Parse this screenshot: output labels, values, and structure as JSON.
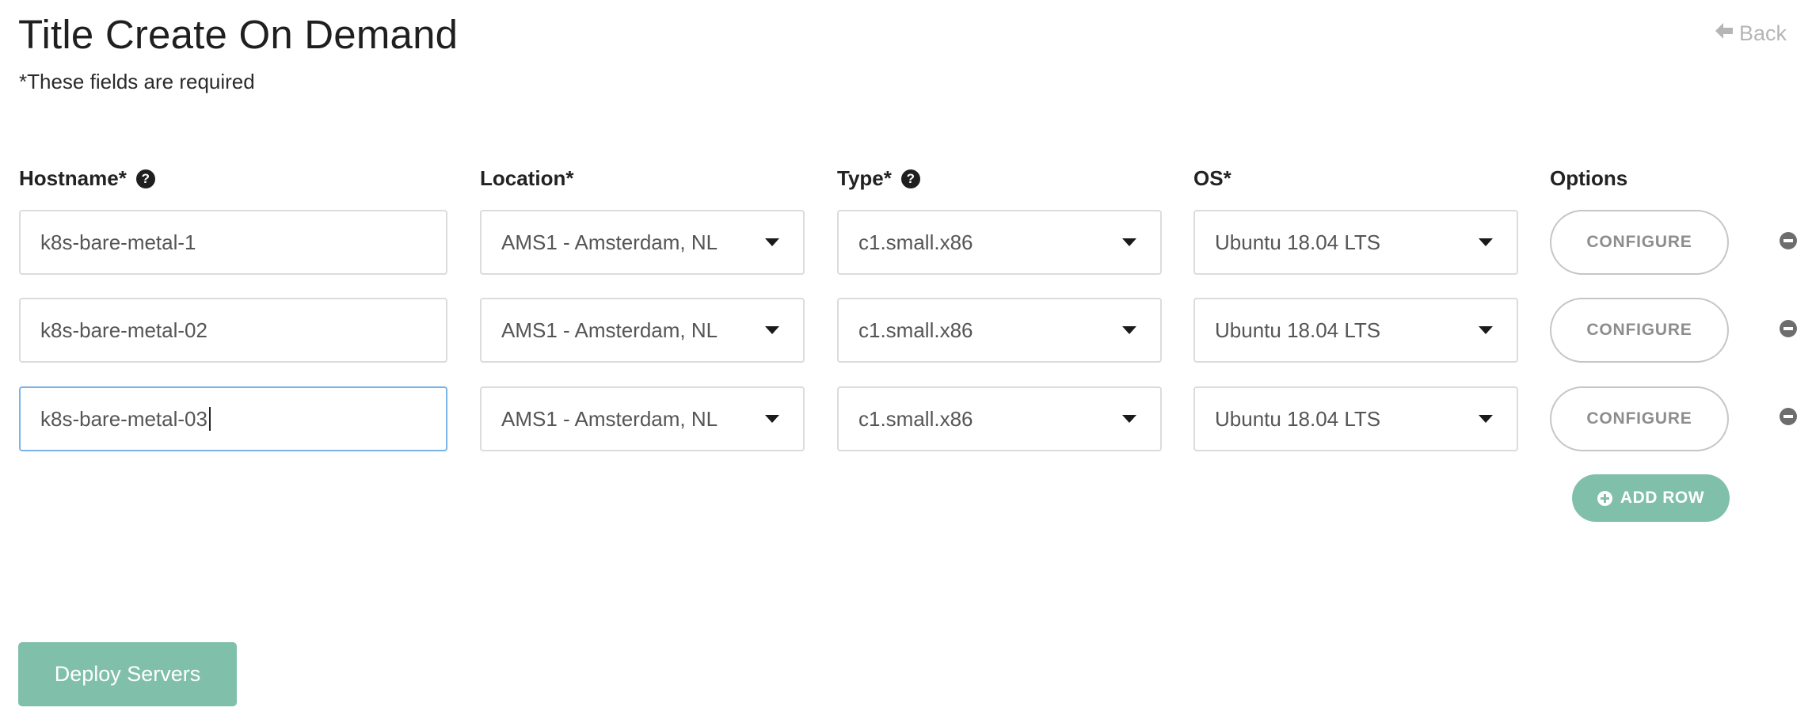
{
  "header": {
    "title": "Title Create On Demand",
    "subtitle": "*These fields are required",
    "back_label": "Back"
  },
  "columns": {
    "hostname": "Hostname*",
    "location": "Location*",
    "type": "Type*",
    "os": "OS*",
    "options": "Options"
  },
  "rows": [
    {
      "hostname": "k8s-bare-metal-1",
      "location": "AMS1 - Amsterdam, NL",
      "type": "c1.small.x86",
      "os": "Ubuntu 18.04 LTS",
      "configure_label": "CONFIGURE"
    },
    {
      "hostname": "k8s-bare-metal-02",
      "location": "AMS1 - Amsterdam, NL",
      "type": "c1.small.x86",
      "os": "Ubuntu 18.04 LTS",
      "configure_label": "CONFIGURE"
    },
    {
      "hostname": "k8s-bare-metal-03",
      "location": "AMS1 - Amsterdam, NL",
      "type": "c1.small.x86",
      "os": "Ubuntu 18.04 LTS",
      "configure_label": "CONFIGURE"
    }
  ],
  "actions": {
    "add_row_label": "ADD ROW",
    "deploy_label": "Deploy Servers"
  },
  "colors": {
    "accent": "#80c0ab",
    "focus_border": "#7ab4e6",
    "muted_text": "#b5b5b5"
  },
  "icons": [
    "arrow-left-icon",
    "help-icon",
    "chevron-down-icon",
    "remove-row-icon",
    "plus-circle-icon"
  ]
}
